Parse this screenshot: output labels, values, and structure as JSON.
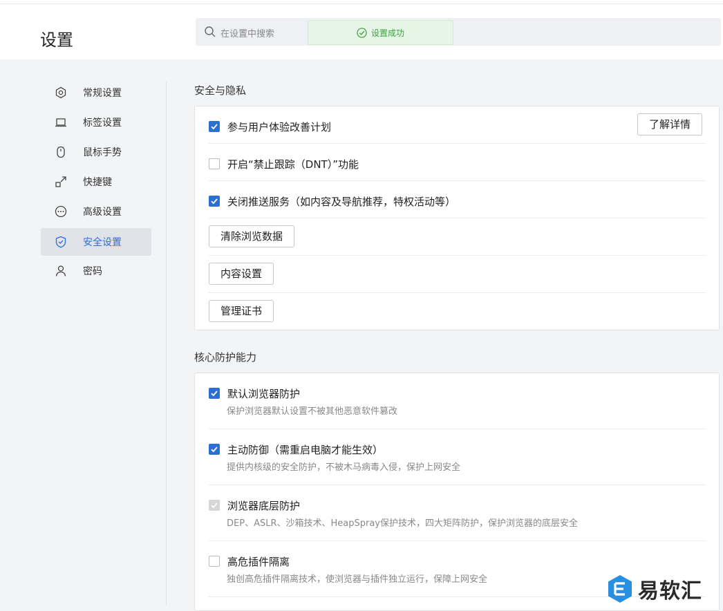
{
  "header": {
    "title": "设置",
    "search_placeholder": "在设置中搜索",
    "toast": "设置成功"
  },
  "sidebar": {
    "items": [
      {
        "label": "常规设置",
        "icon": "hexagon-gear-icon"
      },
      {
        "label": "标签设置",
        "icon": "laptop-tab-icon"
      },
      {
        "label": "鼠标手势",
        "icon": "mouse-icon"
      },
      {
        "label": "快捷键",
        "icon": "shortcut-arrow-icon"
      },
      {
        "label": "高级设置",
        "icon": "more-dots-icon"
      },
      {
        "label": "安全设置",
        "icon": "shield-check-icon",
        "active": true
      },
      {
        "label": "密码",
        "icon": "user-icon"
      }
    ]
  },
  "security": {
    "title": "安全与隐私",
    "ux_program": {
      "label": "参与用户体验改善计划",
      "checked": true,
      "button": "了解详情"
    },
    "dnt": {
      "label": "开启“禁止跟踪（DNT）”功能",
      "checked": false
    },
    "push": {
      "label": "关闭推送服务（如内容及导航推荐，特权活动等）",
      "checked": true
    },
    "clear_data_button": "清除浏览数据",
    "content_settings_button": "内容设置",
    "certs_button": "管理证书"
  },
  "core": {
    "title": "核心防护能力",
    "items": [
      {
        "label": "默认浏览器防护",
        "desc": "保护浏览器默认设置不被其他恶意软件篡改",
        "state": "checked"
      },
      {
        "label": "主动防御（需重启电脑才能生效）",
        "desc": "提供内核级的安全防护，不被木马病毒入侵，保护上网安全",
        "state": "checked"
      },
      {
        "label": "浏览器底层防护",
        "desc": "DEP、ASLR、沙箱技术、HeapSpray保护技术，四大矩阵防护，保护浏览器的底层安全",
        "state": "disabled-checked"
      },
      {
        "label": "高危插件隔离",
        "desc": "独创高危插件隔离技术，使浏览器与插件独立运行，保障上网安全",
        "state": "unchecked"
      }
    ]
  },
  "watermark": {
    "text": "易软汇"
  },
  "colors": {
    "accent": "#2b6fd3",
    "success": "#3aa13a",
    "toast_bg": "#e6f6e6"
  }
}
